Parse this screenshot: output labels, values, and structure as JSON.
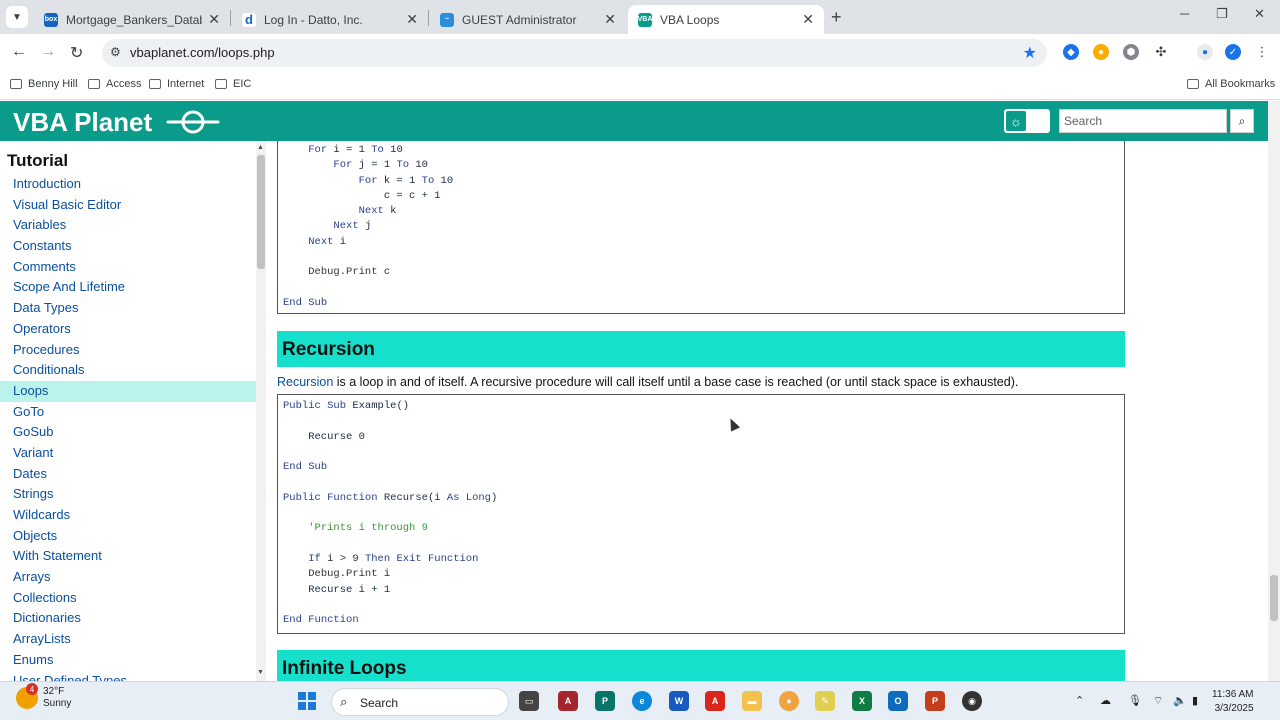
{
  "browser": {
    "tabs": [
      {
        "title": "Mortgage_Bankers_Database.d",
        "favicon": "box"
      },
      {
        "title": "Log In - Datto, Inc.",
        "favicon": "d"
      },
      {
        "title": "GUEST Administrator",
        "favicon": "wave"
      },
      {
        "title": "VBA Loops",
        "favicon": "VBA"
      }
    ],
    "url": "vbaplanet.com/loops.php",
    "bookmarks": [
      "Benny Hill",
      "Access",
      "Internet",
      "EIC"
    ],
    "all_bookmarks": "All Bookmarks"
  },
  "site": {
    "logo": "VBA Planet",
    "search_placeholder": "Search",
    "accent": "#0b9b8a",
    "section_color": "#16e0cb"
  },
  "sidebar": {
    "title": "Tutorial",
    "items": [
      "Introduction",
      "Visual Basic Editor",
      "Variables",
      "Constants",
      "Comments",
      "Scope And Lifetime",
      "Data Types",
      "Operators",
      "Procedures",
      "Conditionals",
      "Loops",
      "GoTo",
      "GoSub",
      "Variant",
      "Dates",
      "Strings",
      "Wildcards",
      "Objects",
      "With Statement",
      "Arrays",
      "Collections",
      "Dictionaries",
      "ArrayLists",
      "Enums",
      "User Defined Types"
    ],
    "active": "Loops"
  },
  "content": {
    "code1": [
      "    For i = 1 To 10",
      "        For j = 1 To 10",
      "            For k = 1 To 10",
      "                c = c + 1",
      "            Next k",
      "        Next j",
      "    Next i",
      "",
      "    Debug.Print c",
      "",
      "End Sub"
    ],
    "recursion_heading": "Recursion",
    "recursion_link": "Recursion",
    "recursion_text": " is a loop in and of itself. A recursive procedure will call itself until a base case is reached (or until stack space is exhausted).",
    "code2": [
      "Public Sub Example()",
      "",
      "    Recurse 0",
      "",
      "End Sub",
      "",
      "Public Function Recurse(i As Long)",
      "",
      "    'Prints i through 9",
      "",
      "    If i > 9 Then Exit Function",
      "    Debug.Print i",
      "    Recurse i + 1",
      "",
      "End Function"
    ],
    "infinite_heading": "Infinite Loops"
  },
  "taskbar": {
    "weather_temp": "32°F",
    "weather_desc": "Sunny",
    "weather_badge": "4",
    "search_label": "Search",
    "time": "11:36 AM",
    "date": "3/3/2025"
  }
}
